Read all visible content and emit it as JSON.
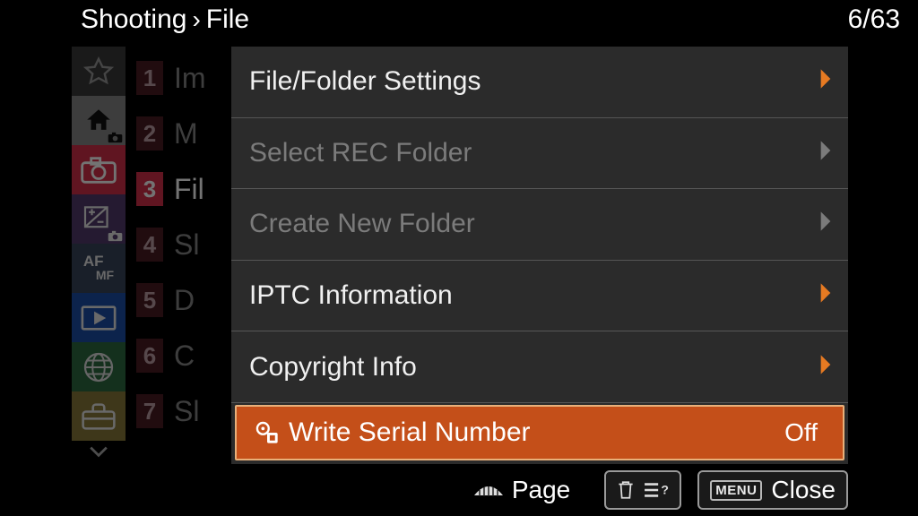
{
  "header": {
    "crumb1": "Shooting",
    "crumb2": "File",
    "page_indicator": "6/63"
  },
  "rail": {
    "icons": [
      "star",
      "home-cam",
      "camera",
      "exposure-cam",
      "afmf",
      "play",
      "globe",
      "toolbox"
    ]
  },
  "numcol": [
    {
      "n": "1",
      "frag": "Im",
      "sel": false
    },
    {
      "n": "2",
      "frag": "M",
      "sel": false
    },
    {
      "n": "3",
      "frag": "Fil",
      "sel": true
    },
    {
      "n": "4",
      "frag": "Sl",
      "sel": false
    },
    {
      "n": "5",
      "frag": "D",
      "sel": false
    },
    {
      "n": "6",
      "frag": "C",
      "sel": false
    },
    {
      "n": "7",
      "frag": "Sl",
      "sel": false
    }
  ],
  "panel": [
    {
      "label": "File/Folder Settings",
      "state": "normal",
      "rhs": "chev-orange"
    },
    {
      "label": "Select REC Folder",
      "state": "disabled",
      "rhs": "chev-grey"
    },
    {
      "label": "Create New Folder",
      "state": "disabled",
      "rhs": "chev-grey"
    },
    {
      "label": "IPTC Information",
      "state": "normal",
      "rhs": "chev-orange"
    },
    {
      "label": "Copyright Info",
      "state": "normal",
      "rhs": "chev-orange"
    },
    {
      "label": "Write Serial Number",
      "state": "selected",
      "rhs": "value",
      "value": "Off",
      "icon": "gear"
    }
  ],
  "help": {
    "page_label": "Page",
    "close_label": "Close",
    "menu_badge": "MENU"
  }
}
